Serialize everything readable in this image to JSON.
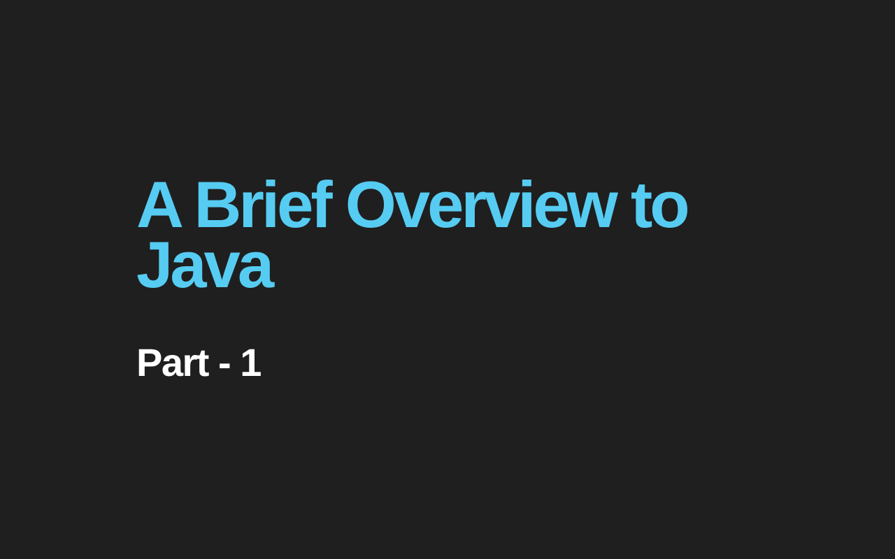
{
  "slide": {
    "title_line1": "A Brief Overview to",
    "title_line2": "Java",
    "subtitle": "Part - 1"
  },
  "colors": {
    "background": "#1f1f1f",
    "title": "#56ccf2",
    "subtitle": "#ffffff"
  }
}
